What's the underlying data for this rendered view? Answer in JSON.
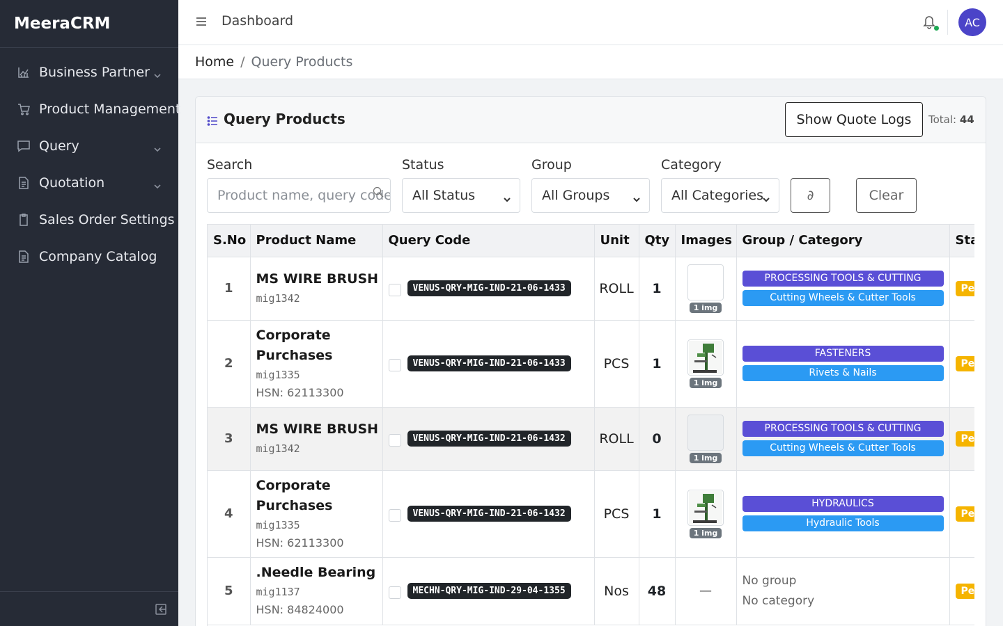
{
  "app": {
    "brand": "MeeraCRM",
    "page_title": "Dashboard",
    "avatar_initials": "AC"
  },
  "sidebar": {
    "items": [
      {
        "label": "Business Partner",
        "icon": "chart-icon",
        "has_submenu": true
      },
      {
        "label": "Product Management",
        "icon": "cart-icon",
        "has_submenu": false
      },
      {
        "label": "Query",
        "icon": "message-icon",
        "has_submenu": true
      },
      {
        "label": "Quotation",
        "icon": "document-icon",
        "has_submenu": true
      },
      {
        "label": "Sales Order Settings",
        "icon": "clipboard-icon",
        "has_submenu": false
      },
      {
        "label": "Company Catalog",
        "icon": "document-icon",
        "has_submenu": false
      }
    ]
  },
  "breadcrumb": {
    "home": "Home",
    "separator": "/",
    "current": "Query Products"
  },
  "card": {
    "title": "Query Products",
    "show_logs_label": "Show Quote Logs",
    "total_label": "Total:",
    "total_value": "44"
  },
  "filters": {
    "search_label": "Search",
    "search_placeholder": "Product name, query code",
    "status_label": "Status",
    "status_value": "All Status",
    "group_label": "Group",
    "group_value": "All Groups",
    "category_label": "Category",
    "category_value": "All Categories",
    "refresh_glyph": "∂",
    "clear_label": "Clear"
  },
  "table": {
    "headers": [
      "S.No",
      "Product Name",
      "Query Code",
      "Unit",
      "Qty",
      "Images",
      "Group / Category",
      "Sta"
    ],
    "rows": [
      {
        "sno": "1",
        "name": "MS WIRE BRUSH",
        "code": "mig1342",
        "hsn": "",
        "query_code": "VENUS-QRY-MIG-IND-21-06-1433",
        "unit": "ROLL",
        "qty": "1",
        "images": "1 img",
        "has_thumb": false,
        "group": "PROCESSING TOOLS & CUTTING",
        "category": "Cutting Wheels & Cutter Tools",
        "status": "Pe"
      },
      {
        "sno": "2",
        "name": "Corporate Purchases",
        "code": "mig1335",
        "hsn": "HSN: 62113300",
        "query_code": "VENUS-QRY-MIG-IND-21-06-1433",
        "unit": "PCS",
        "qty": "1",
        "images": "1 img",
        "has_thumb": true,
        "group": "FASTENERS",
        "category": "Rivets & Nails",
        "status": "Pe"
      },
      {
        "sno": "3",
        "name": "MS WIRE BRUSH",
        "code": "mig1342",
        "hsn": "",
        "query_code": "VENUS-QRY-MIG-IND-21-06-1432",
        "unit": "ROLL",
        "qty": "0",
        "images": "1 img",
        "has_thumb": false,
        "group": "PROCESSING TOOLS & CUTTING",
        "category": "Cutting Wheels & Cutter Tools",
        "status": "Pe"
      },
      {
        "sno": "4",
        "name": "Corporate Purchases",
        "code": "mig1335",
        "hsn": "HSN: 62113300",
        "query_code": "VENUS-QRY-MIG-IND-21-06-1432",
        "unit": "PCS",
        "qty": "1",
        "images": "1 img",
        "has_thumb": true,
        "group": "HYDRAULICS",
        "category": "Hydraulic Tools",
        "status": "Pe"
      },
      {
        "sno": "5",
        "name": ".Needle Bearing",
        "code": "mig1137",
        "hsn": "HSN: 84824000",
        "query_code": "MECHN-QRY-MIG-IND-29-04-1355",
        "unit": "Nos",
        "qty": "48",
        "images": "—",
        "no_group": "No group",
        "no_category": "No category",
        "status": "Pe"
      }
    ]
  },
  "colors": {
    "sidebar_bg": "#262b36",
    "accent": "#4b44c8",
    "group_badge": "#5a4fd6",
    "category_badge": "#2b9af3",
    "status_pending": "#f5b400"
  }
}
